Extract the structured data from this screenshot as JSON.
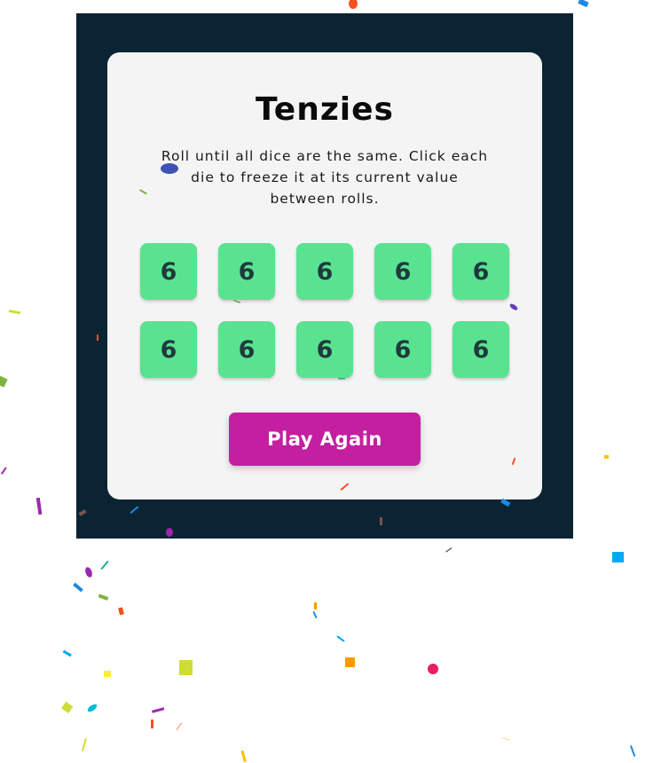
{
  "game": {
    "title": "Tenzies",
    "instructions": "Roll until all dice are the same. Click each die to freeze it at its current value between rolls.",
    "dice": [
      {
        "value": "6"
      },
      {
        "value": "6"
      },
      {
        "value": "6"
      },
      {
        "value": "6"
      },
      {
        "value": "6"
      },
      {
        "value": "6"
      },
      {
        "value": "6"
      },
      {
        "value": "6"
      },
      {
        "value": "6"
      },
      {
        "value": "6"
      }
    ],
    "button_label": "Play Again"
  },
  "colors": {
    "frame_background": "#0b2434",
    "card_background": "#f4f4f4",
    "die_held": "#59e391",
    "button": "#c41fa0"
  }
}
